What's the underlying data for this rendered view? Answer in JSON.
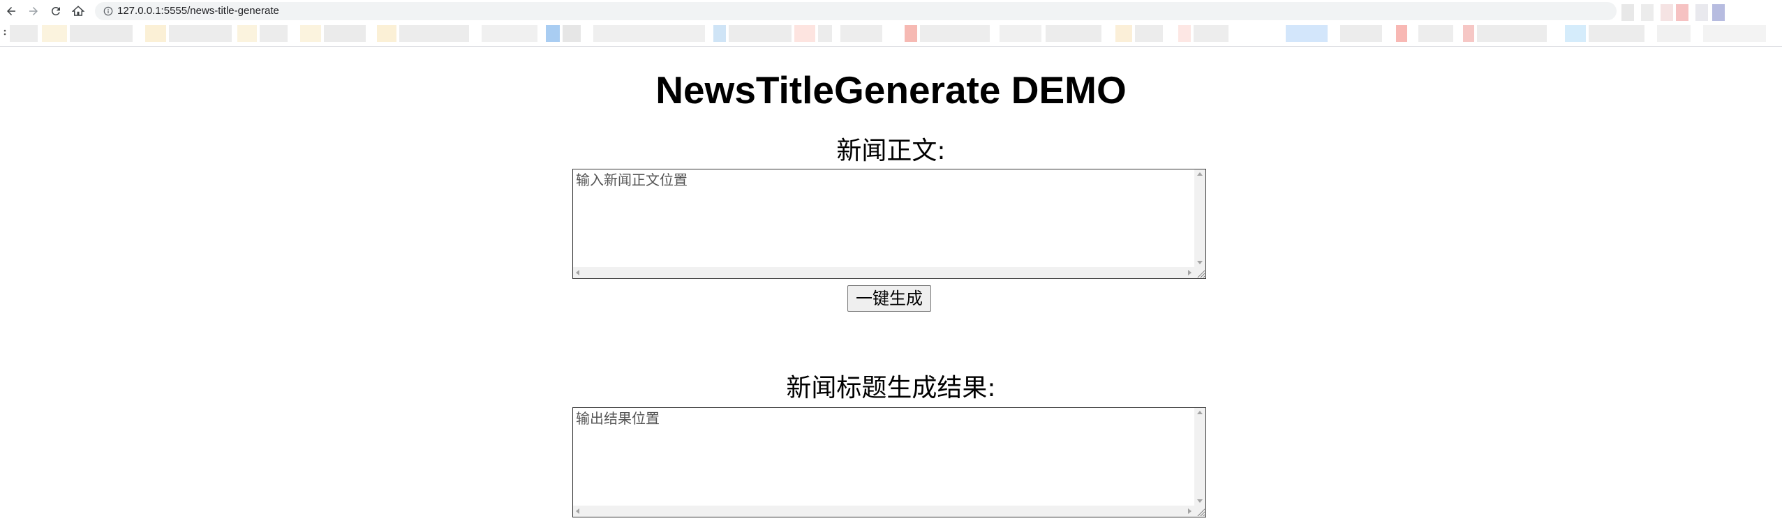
{
  "browser": {
    "url": "127.0.0.1:5555/news-title-generate",
    "icons": {
      "back": "arrow-left-icon",
      "forward": "arrow-right-icon",
      "reload": "reload-icon",
      "home": "home-icon",
      "site_info": "info-icon"
    }
  },
  "page": {
    "title": "NewsTitleGenerate DEMO",
    "input_section": {
      "label": "新闻正文:",
      "placeholder": "输入新闻正文位置",
      "value": ""
    },
    "generate_button": {
      "label": "一键生成"
    },
    "output_section": {
      "label": "新闻标题生成结果:",
      "placeholder": "输出结果位置",
      "value": ""
    }
  }
}
